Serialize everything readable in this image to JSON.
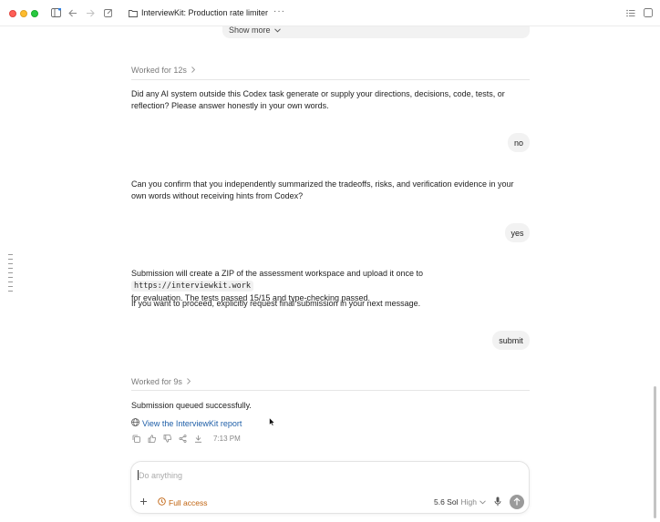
{
  "window": {
    "title": "InterviewKit: Production rate limiter",
    "more_label": "···"
  },
  "conversation": {
    "show_more": "Show more",
    "worked_1": "Worked for 12s",
    "assistant_1": "Did any AI system outside this Codex task generate or supply your directions, decisions, code, tests, or reflection? Please answer honestly in your own words.",
    "user_1": "no",
    "assistant_2": "Can you confirm that you independently summarized the tradeoffs, risks, and verification evidence in your own words without receiving hints from Codex?",
    "user_2": "yes",
    "assistant_3_pre": "Submission will create a ZIP of the assessment workspace and upload it once to",
    "assistant_3_code": "https://interviewkit.work",
    "assistant_3_post": "for evaluation. The tests passed 15/15 and type-checking passed.",
    "assistant_4": "If you want to proceed, explicitly request final submission in your next message.",
    "user_3": "submit",
    "worked_2": "Worked for 9s",
    "assistant_5": "Submission queued successfully.",
    "report_link": "View the InterviewKit report",
    "timestamp": "7:13 PM"
  },
  "composer": {
    "placeholder": "Do anything",
    "access_label": "Full access",
    "model_label": "5.6 Sol",
    "effort_label": "High"
  },
  "colors": {
    "accent_link": "#1f5fa8",
    "access_orange": "#c0630f",
    "bubble_bg": "#f2f2f2"
  }
}
